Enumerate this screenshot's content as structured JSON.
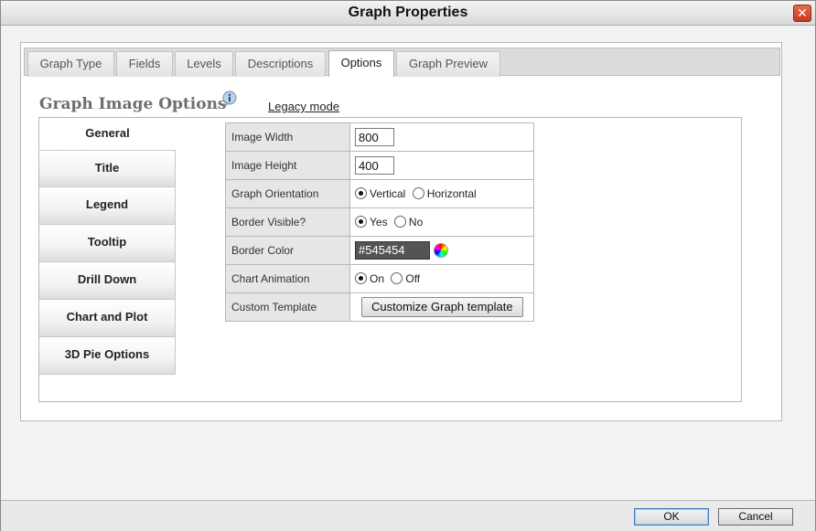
{
  "window": {
    "title": "Graph Properties",
    "close_glyph": "✕"
  },
  "tabs": [
    {
      "label": "Graph Type"
    },
    {
      "label": "Fields"
    },
    {
      "label": "Levels"
    },
    {
      "label": "Descriptions"
    },
    {
      "label": "Options",
      "active": true
    },
    {
      "label": "Graph Preview"
    }
  ],
  "section": {
    "title": "Graph Image Options",
    "legacy_link": "Legacy mode",
    "info_icon": "info-icon"
  },
  "side_tabs": [
    {
      "label": "General",
      "active": true
    },
    {
      "label": "Title"
    },
    {
      "label": "Legend"
    },
    {
      "label": "Tooltip"
    },
    {
      "label": "Drill Down"
    },
    {
      "label": "Chart and Plot"
    },
    {
      "label": "3D Pie Options"
    }
  ],
  "properties": {
    "image_width": {
      "label": "Image Width",
      "value": "800"
    },
    "image_height": {
      "label": "Image Height",
      "value": "400"
    },
    "orientation": {
      "label": "Graph Orientation",
      "options": [
        "Vertical",
        "Horizontal"
      ],
      "selected": "Vertical"
    },
    "border_visible": {
      "label": "Border Visible?",
      "options": [
        "Yes",
        "No"
      ],
      "selected": "Yes"
    },
    "border_color": {
      "label": "Border Color",
      "value": "#545454"
    },
    "chart_animation": {
      "label": "Chart Animation",
      "options": [
        "On",
        "Off"
      ],
      "selected": "On"
    },
    "custom_template": {
      "label": "Custom Template",
      "button": "Customize Graph template"
    }
  },
  "footer": {
    "ok_label": "OK",
    "cancel_label": "Cancel"
  },
  "colors": {
    "border_color_swatch": "#545454",
    "close_button": "#d9482b"
  }
}
